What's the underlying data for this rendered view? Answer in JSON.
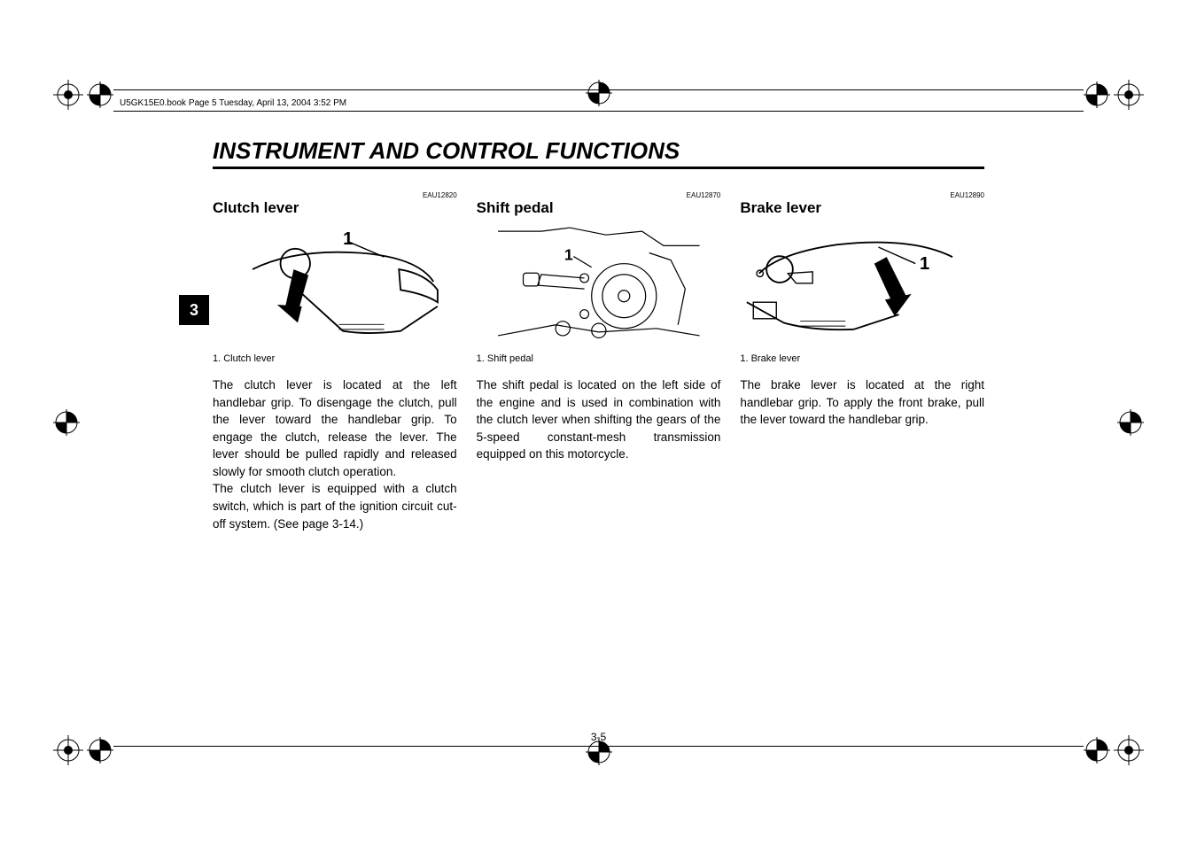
{
  "header": {
    "label": "U5GK15E0.book  Page 5  Tuesday, April 13, 2004  3:52 PM"
  },
  "chapter_tab": "3",
  "page_title": "INSTRUMENT AND CONTROL FUNCTIONS",
  "page_number": "3-5",
  "columns": [
    {
      "code": "EAU12820",
      "heading": "Clutch lever",
      "callout": "1",
      "caption": "1. Clutch lever",
      "paragraphs": [
        "The clutch lever is located at the left handlebar grip. To disengage the clutch, pull the lever toward the handlebar grip. To engage the clutch, release the lever. The lever should be pulled rapidly and released slowly for smooth clutch operation.",
        "The clutch lever is equipped with a clutch switch, which is part of the ignition circuit cut-off system. (See page 3-14.)"
      ]
    },
    {
      "code": "EAU12870",
      "heading": "Shift pedal",
      "callout": "1",
      "caption": "1. Shift pedal",
      "paragraphs": [
        "The shift pedal is located on the left side of the engine and is used in combination with the clutch lever when shifting the gears of the 5-speed constant-mesh transmission equipped on this motorcycle."
      ]
    },
    {
      "code": "EAU12890",
      "heading": "Brake lever",
      "callout": "1",
      "caption": "1. Brake lever",
      "paragraphs": [
        "The brake lever is located at the right handlebar grip. To apply the front brake, pull the lever toward the handlebar grip."
      ]
    }
  ]
}
